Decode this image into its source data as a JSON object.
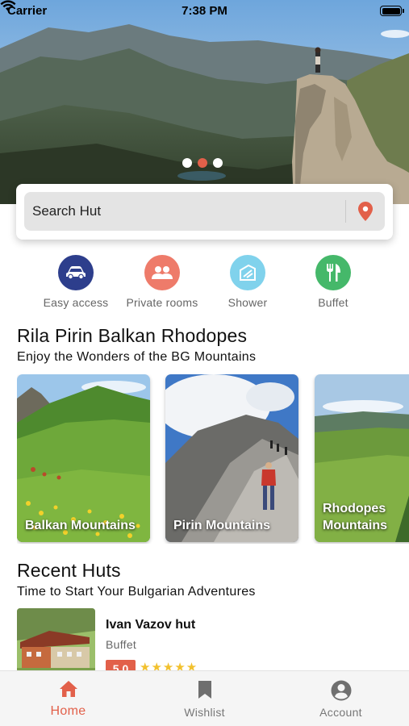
{
  "status_bar": {
    "carrier": "Carrier",
    "time": "7:38 PM"
  },
  "hero": {
    "slide_count": 3,
    "active_slide": 2
  },
  "search": {
    "placeholder": "Search Hut"
  },
  "amenities": [
    {
      "label": "Easy access",
      "icon": "car-icon",
      "color": "#2d3e8c"
    },
    {
      "label": "Private rooms",
      "icon": "people-icon",
      "color": "#ee7b6a"
    },
    {
      "label": "Shower",
      "icon": "shower-icon",
      "color": "#80d2ec"
    },
    {
      "label": "Buffet",
      "icon": "fork-knife-icon",
      "color": "#45b86a"
    }
  ],
  "mountains_section": {
    "title": "Rila Pirin Balkan Rhodopes",
    "subtitle": "Enjoy the Wonders of the BG Mountains",
    "cards": [
      {
        "label": "Balkan Mountains"
      },
      {
        "label": "Pirin Mountains"
      },
      {
        "label": "Rhodopes Mountains"
      }
    ]
  },
  "recent_section": {
    "title": "Recent Huts",
    "subtitle": "Time to Start Your Bulgarian Adventures",
    "huts": [
      {
        "name": "Ivan Vazov hut",
        "tag": "Buffet",
        "rating": "5.0",
        "stars": 5
      }
    ]
  },
  "tab_bar": {
    "home": "Home",
    "wishlist": "Wishlist",
    "account": "Account"
  },
  "colors": {
    "accent": "#e2604a"
  }
}
